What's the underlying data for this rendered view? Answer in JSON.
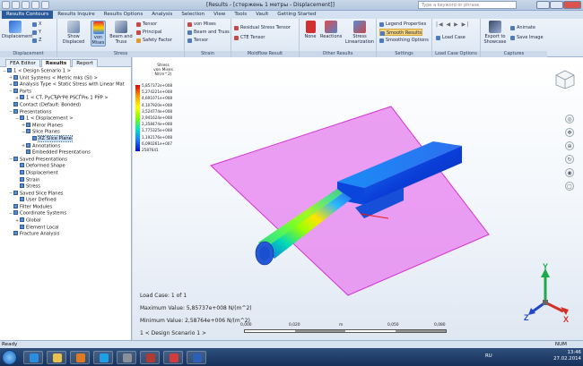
{
  "window": {
    "title": "[Results - [стержень 1 метры - Displacement]]",
    "search_placeholder": "Type a keyword or phrase"
  },
  "ribbon_tabs": [
    "Results Contours",
    "Results Inquire",
    "Results Options",
    "Analysis",
    "Selection",
    "View",
    "Tools",
    "Vault",
    "Getting Started"
  ],
  "ribbon": {
    "displacement": {
      "btn_displacement": "Displacement",
      "btn_x": "X",
      "btn_y": "Y",
      "btn_z": "Z",
      "label": "Displacement"
    },
    "stress": {
      "btn_show_displaced": "Show Displaced",
      "btn_von_mises": "von Mises",
      "btn_beam_truss": "Beam and Truss",
      "btn_tensor": "Tensor",
      "btn_principal": "Principal",
      "btn_safety": "Safety Factor",
      "label": "Stress"
    },
    "strain": {
      "btn_vm": "von Mises",
      "btn_beam": "Beam and Truss",
      "btn_tensor": "Tensor",
      "label": "Strain"
    },
    "multiflow": {
      "btn_residual": "Residual Stress Tensor",
      "btn_cte": "CTE Tensor",
      "label": "Moldflow Result"
    },
    "other": {
      "btn_none": "None",
      "btn_reactions": "Reactions",
      "btn_stress_lin": "Stress Linearization",
      "label": "Other Results"
    },
    "settings": {
      "btn_legend": "Legend Properties",
      "btn_smooth": "Smooth Results",
      "btn_smoothing": "Smoothing Options",
      "label": "Settings"
    },
    "loadcase": {
      "btn_load_case": "Load Case",
      "label": "Load Case Options"
    },
    "captures": {
      "btn_export": "Export to Showcase",
      "btn_animate": "Animate",
      "btn_save_image": "Save Image",
      "label": "Captures"
    }
  },
  "panel_tabs": [
    "FEA Editor",
    "Results",
    "Report"
  ],
  "tree": [
    {
      "text": "1 < Design Scenario 1 >",
      "level": 0,
      "toggle": "−"
    },
    {
      "text": "Unit Systems < Metric mks (SI) >",
      "level": 1,
      "toggle": "+"
    },
    {
      "text": "Analysis Type < Static Stress with Linear Mat",
      "level": 1,
      "toggle": "+"
    },
    {
      "text": "Parts",
      "level": 1,
      "toggle": "−"
    },
    {
      "text": "1 < СТ, РуСЂРґРё РЅСЃРњ 1 РЎР >",
      "level": 2,
      "toggle": "+"
    },
    {
      "text": "Contact (Default: Bonded)",
      "level": 1,
      "toggle": ""
    },
    {
      "text": "Presentations",
      "level": 1,
      "toggle": "−"
    },
    {
      "text": "1 < Displacement >",
      "level": 2,
      "toggle": "−"
    },
    {
      "text": "Mirror Planes",
      "level": 3,
      "toggle": "+"
    },
    {
      "text": "Slice Planes",
      "level": 3,
      "toggle": "−"
    },
    {
      "text": "XZ Slice Plane",
      "level": 4,
      "toggle": "",
      "selected": true
    },
    {
      "text": "Annotations",
      "level": 3,
      "toggle": "+"
    },
    {
      "text": "Embedded Presentations",
      "level": 3,
      "toggle": ""
    },
    {
      "text": "Saved Presentations",
      "level": 1,
      "toggle": "−"
    },
    {
      "text": "Deformed Shape",
      "level": 2,
      "toggle": ""
    },
    {
      "text": "Displacement",
      "level": 2,
      "toggle": ""
    },
    {
      "text": "Strain",
      "level": 2,
      "toggle": ""
    },
    {
      "text": "Stress",
      "level": 2,
      "toggle": ""
    },
    {
      "text": "Saved Slice Planes",
      "level": 1,
      "toggle": "−"
    },
    {
      "text": "User Defined",
      "level": 2,
      "toggle": ""
    },
    {
      "text": "Filter Modules",
      "level": 1,
      "toggle": ""
    },
    {
      "text": "Coordinate Systems",
      "level": 1,
      "toggle": "−"
    },
    {
      "text": "Global",
      "level": 2,
      "toggle": "+"
    },
    {
      "text": "Element Local",
      "level": 2,
      "toggle": ""
    },
    {
      "text": "Fracture Analysis",
      "level": 1,
      "toggle": ""
    }
  ],
  "legend": {
    "title_line1": "Stress",
    "title_line2": "von Mises",
    "title_line3": "N/(m^2)",
    "values": [
      "5,857372e+008",
      "5,274221e+008",
      "4,691071e+008",
      "4,107920e+008",
      "3,524774e+008",
      "2,941624e+008",
      "2,358474e+008",
      "1,775325e+008",
      "1,192176e+008",
      "6,090261e+007",
      "2587641"
    ]
  },
  "viewport": {
    "load_case": "Load Case:  1 of 1",
    "max_value": "Maximum Value: 5,85737e+008 N/(m^2)",
    "min_value": "Minimum Value: 2,58764e+006 N/(m^2)",
    "scenario": "1 < Design Scenario 1 >",
    "scale_labels": [
      "0,000",
      "0,020",
      "m",
      "0,050",
      "0,080"
    ]
  },
  "triad": {
    "x": "X",
    "y": "Y",
    "z": "Z"
  },
  "status": {
    "left": "Ready",
    "right": "NUM"
  },
  "taskbar": {
    "lang": "RU",
    "time": "13:46",
    "date": "27.02.2014"
  },
  "colors": {
    "slice_plane": "#e78df0",
    "slice_edge": "#d434d4",
    "active_tab": "#2b5a9a",
    "highlight": "#f6d27a"
  }
}
